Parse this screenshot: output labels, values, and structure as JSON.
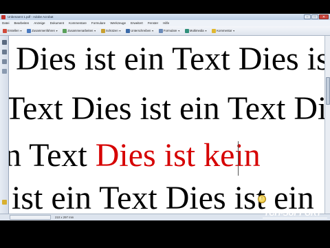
{
  "window": {
    "title": "Unbenannt 1.pdf - Adobe Acrobat",
    "controls": [
      "–",
      "□",
      "✕"
    ]
  },
  "menubar": {
    "items": [
      "Datei",
      "Bearbeiten",
      "Anzeige",
      "Dokument",
      "Kommentare",
      "Formulare",
      "Werkzeuge",
      "Erweitert",
      "Fenster",
      "Hilfe"
    ]
  },
  "toolbar": {
    "create_label": "Erstellen",
    "combine_label": "Zusammenführen",
    "collaborate_label": "Zusammenarbeiten",
    "secure_label": "Schützen",
    "sign_label": "Unterschreiben",
    "forms_label": "Formulare",
    "multimedia_label": "Multimedia",
    "comment_label": "Kommentar",
    "page_current": "1",
    "page_total": "/ 1",
    "zoom": "100%",
    "search_placeholder": "Suchen"
  },
  "document": {
    "lines": [
      "Dies ist ein Text Dies ist ein",
      "Text Dies ist ein Text Dies",
      "n Text Dies ist kein Text",
      "ist ein Text Dies ist ein"
    ],
    "line3_black": "n Text ",
    "line3_red": "Dies ist kein",
    "highlight_color": "#d60000"
  },
  "statusbar": {
    "page_size": "210 x 297 mm"
  },
  "watermark": {
    "text": "TCH-SUPPORT"
  }
}
